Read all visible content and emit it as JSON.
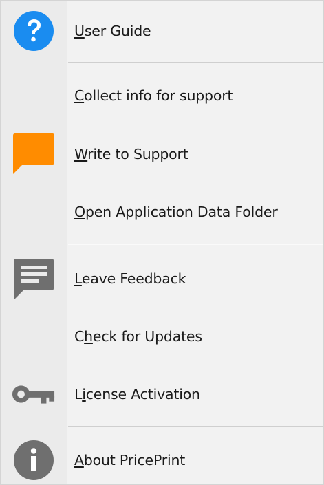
{
  "menu": {
    "items": [
      {
        "id": "user-guide",
        "hotkey": "U",
        "rest": "ser Guide",
        "icon": "help-icon",
        "color": "#1a8cf0"
      },
      {
        "id": "collect-info",
        "hotkey": "C",
        "rest": "ollect info for support",
        "icon": "",
        "color": ""
      },
      {
        "id": "write-support",
        "hotkey": "W",
        "rest": "rite to Support",
        "icon": "speech-bubble-icon",
        "color": "#ff8c00"
      },
      {
        "id": "open-data-folder",
        "hotkey": "O",
        "rest": "pen Application Data Folder",
        "icon": "",
        "color": ""
      },
      {
        "id": "leave-feedback",
        "hotkey": "L",
        "rest": "eave Feedback",
        "icon": "feedback-icon",
        "color": "#6f6f6f"
      },
      {
        "id": "check-updates",
        "pre": "C",
        "hotkey": "h",
        "rest": "eck for Updates",
        "icon": "",
        "color": ""
      },
      {
        "id": "license-activation",
        "pre": "L",
        "hotkey": "i",
        "rest": "cense Activation",
        "icon": "key-icon",
        "color": "#6f6f6f"
      },
      {
        "id": "about",
        "hotkey": "A",
        "rest": "bout PricePrint",
        "icon": "info-icon",
        "color": "#6f6f6f"
      }
    ]
  }
}
